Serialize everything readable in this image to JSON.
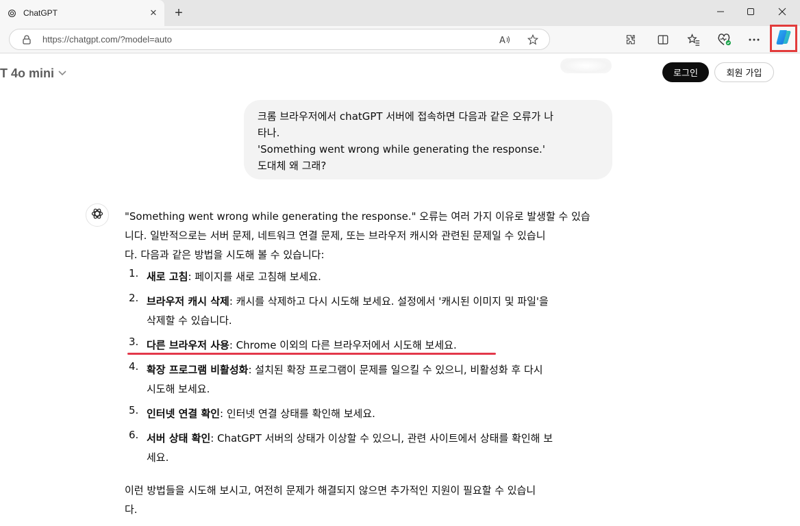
{
  "browser": {
    "tab_title": "ChatGPT",
    "url": "https://chatgpt.com/?model=auto",
    "accent_highlight": "#e23b3b",
    "icons": [
      "lock-icon",
      "read-aloud-icon",
      "favorite-star-icon",
      "extensions-icon",
      "split-screen-icon",
      "favorites-icon",
      "browser-essentials-icon",
      "more-icon",
      "copilot-icon"
    ]
  },
  "header": {
    "model": "T 4o mini",
    "login_label": "로그인",
    "signup_label": "회원 가입"
  },
  "user_message": {
    "lines": [
      "크롬 브라우저에서 chatGPT 서버에 접속하면 다음과 같은 오류가 나",
      "타나.",
      "'Something went wrong while generating the response.'",
      "도대체 왜 그래?"
    ]
  },
  "assistant": {
    "intro_lines": [
      "\"Something went wrong while generating the response.\" 오류는 여러 가지 이유로 발생할 수 있습",
      "니다. 일반적으로는 서버 문제, 네트워크 연결 문제, 또는 브라우저 캐시와 관련된 문제일 수 있습니",
      "다. 다음과 같은 방법을 시도해 볼 수 있습니다:"
    ],
    "items": [
      {
        "num": "1.",
        "title": "새로 고침",
        "line1": ": 페이지를 새로 고침해 보세요.",
        "line2": ""
      },
      {
        "num": "2.",
        "title": "브라우저 캐시 삭제",
        "line1": ": 캐시를 삭제하고 다시 시도해 보세요. 설정에서 '캐시된 이미지 및 파일'을",
        "line2": "삭제할 수 있습니다."
      },
      {
        "num": "3.",
        "title": "다른 브라우저 사용",
        "line1": ": Chrome 이외의 다른 브라우저에서 시도해 보세요.",
        "line2": ""
      },
      {
        "num": "4.",
        "title": "확장 프로그램 비활성화",
        "line1": ": 설치된 확장 프로그램이 문제를 일으킬 수 있으니, 비활성화 후 다시",
        "line2": "시도해 보세요."
      },
      {
        "num": "5.",
        "title": "인터넷 연결 확인",
        "line1": ": 인터넷 연결 상태를 확인해 보세요.",
        "line2": ""
      },
      {
        "num": "6.",
        "title": "서버 상태 확인",
        "line1": ": ChatGPT 서버의 상태가 이상할 수 있으니, 관련 사이트에서 상태를 확인해 보",
        "line2": "세요."
      }
    ],
    "outro_lines": [
      "이런 방법들을 시도해 보시고, 여전히 문제가 해결되지 않으면 추가적인 지원이 필요할 수 있습니",
      "다."
    ],
    "highlight_color": "#e3384a"
  }
}
